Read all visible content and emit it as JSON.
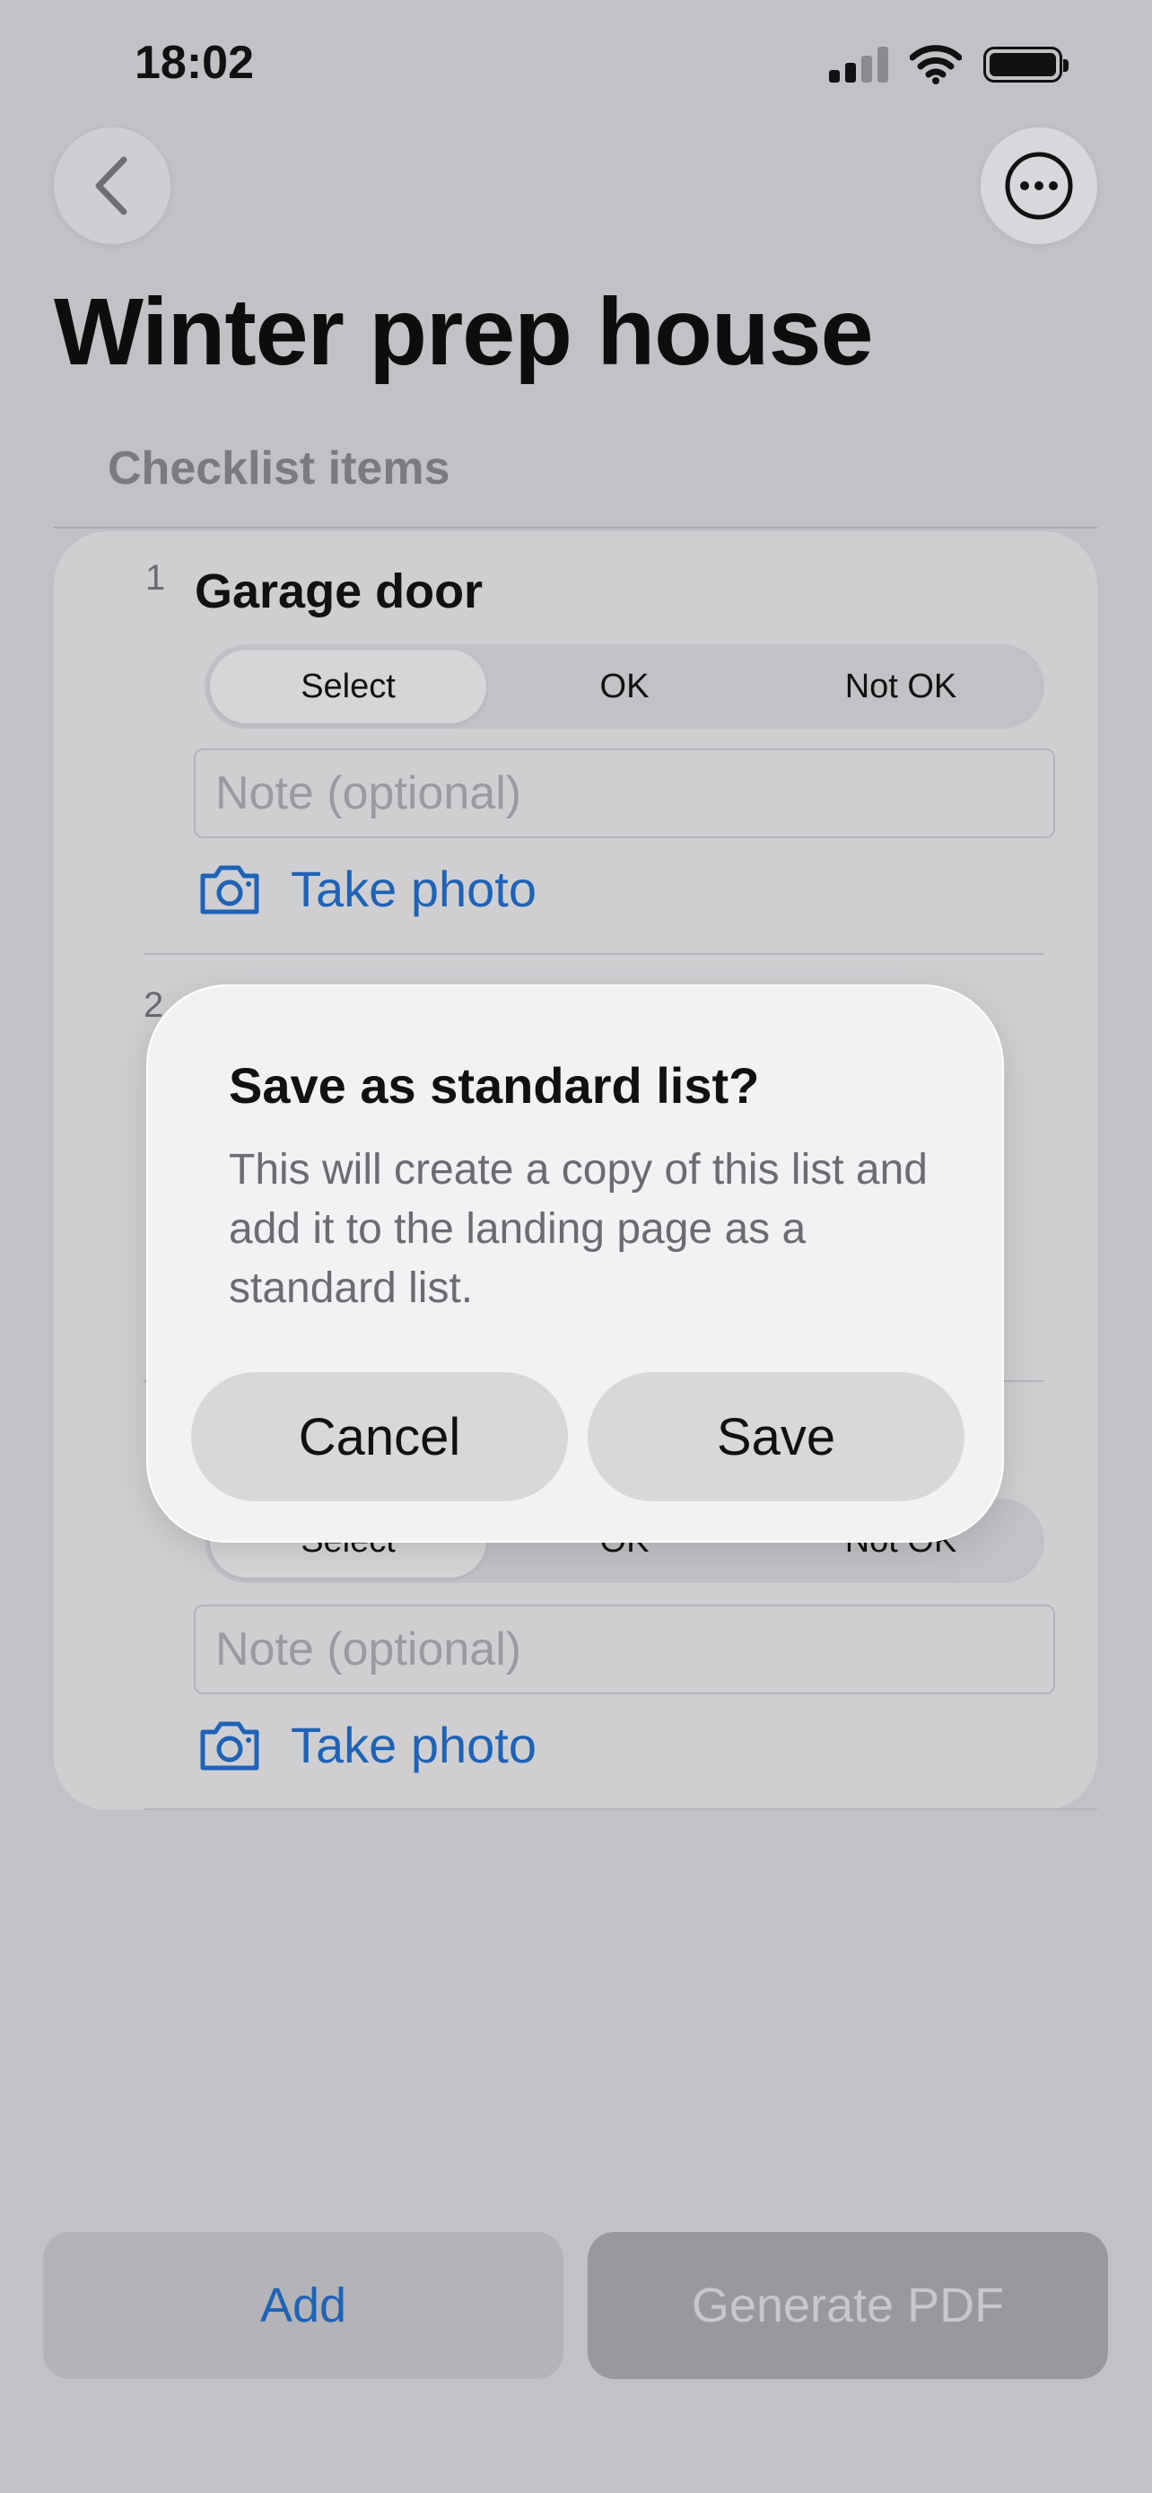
{
  "status_bar": {
    "time": "18:02"
  },
  "page": {
    "title": "Winter prep house",
    "section_label": "Checklist items"
  },
  "items": [
    {
      "number": "1",
      "title": "Garage door",
      "segments": [
        "Select",
        "OK",
        "Not OK"
      ],
      "selected_segment": "Select",
      "note_placeholder": "Note (optional)",
      "photo_label": "Take photo"
    },
    {
      "number": "2"
    },
    {
      "segments": [
        "Select",
        "OK",
        "Not OK"
      ],
      "note_placeholder": "Note (optional)",
      "photo_label": "Take photo"
    }
  ],
  "dialog": {
    "title": "Save as standard list?",
    "message": "This will create a copy of this list and add it to the landing page as a standard list.",
    "cancel_label": "Cancel",
    "save_label": "Save"
  },
  "bottom_bar": {
    "add_label": "Add",
    "pdf_label": "Generate PDF"
  },
  "colors": {
    "accent": "#1e63b6",
    "background": "#c1c1c6",
    "dialog": "#f1f2f4"
  }
}
